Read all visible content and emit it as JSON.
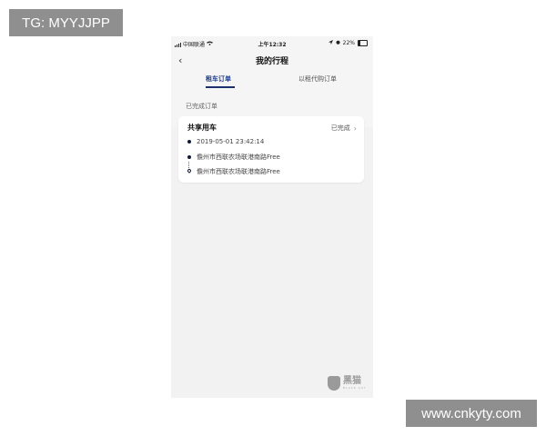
{
  "watermark": {
    "top_left": "TG: MYYJJPP",
    "bottom_right": "www.cnkyty.com"
  },
  "status_bar": {
    "carrier": "中国联通",
    "time": "上午12:32",
    "battery": "22%"
  },
  "nav": {
    "back_icon": "chevron-left-icon",
    "title": "我的行程"
  },
  "tabs": [
    {
      "label": "租车订单",
      "active": true
    },
    {
      "label": "以租代购订单",
      "active": false
    }
  ],
  "section_title": "已完成订单",
  "order_card": {
    "title": "共享用车",
    "status": "已完成",
    "datetime": "2019-05-01 23:42:14",
    "start_address": "儋州市西联农场联港南路Free",
    "end_address": "儋州市西联农场联港南路Free"
  },
  "logo": {
    "text": "黑猫",
    "sub": "BLACK CAT"
  },
  "colors": {
    "accent": "#1a3a8a",
    "background": "#f2f2f2",
    "card": "#ffffff"
  }
}
